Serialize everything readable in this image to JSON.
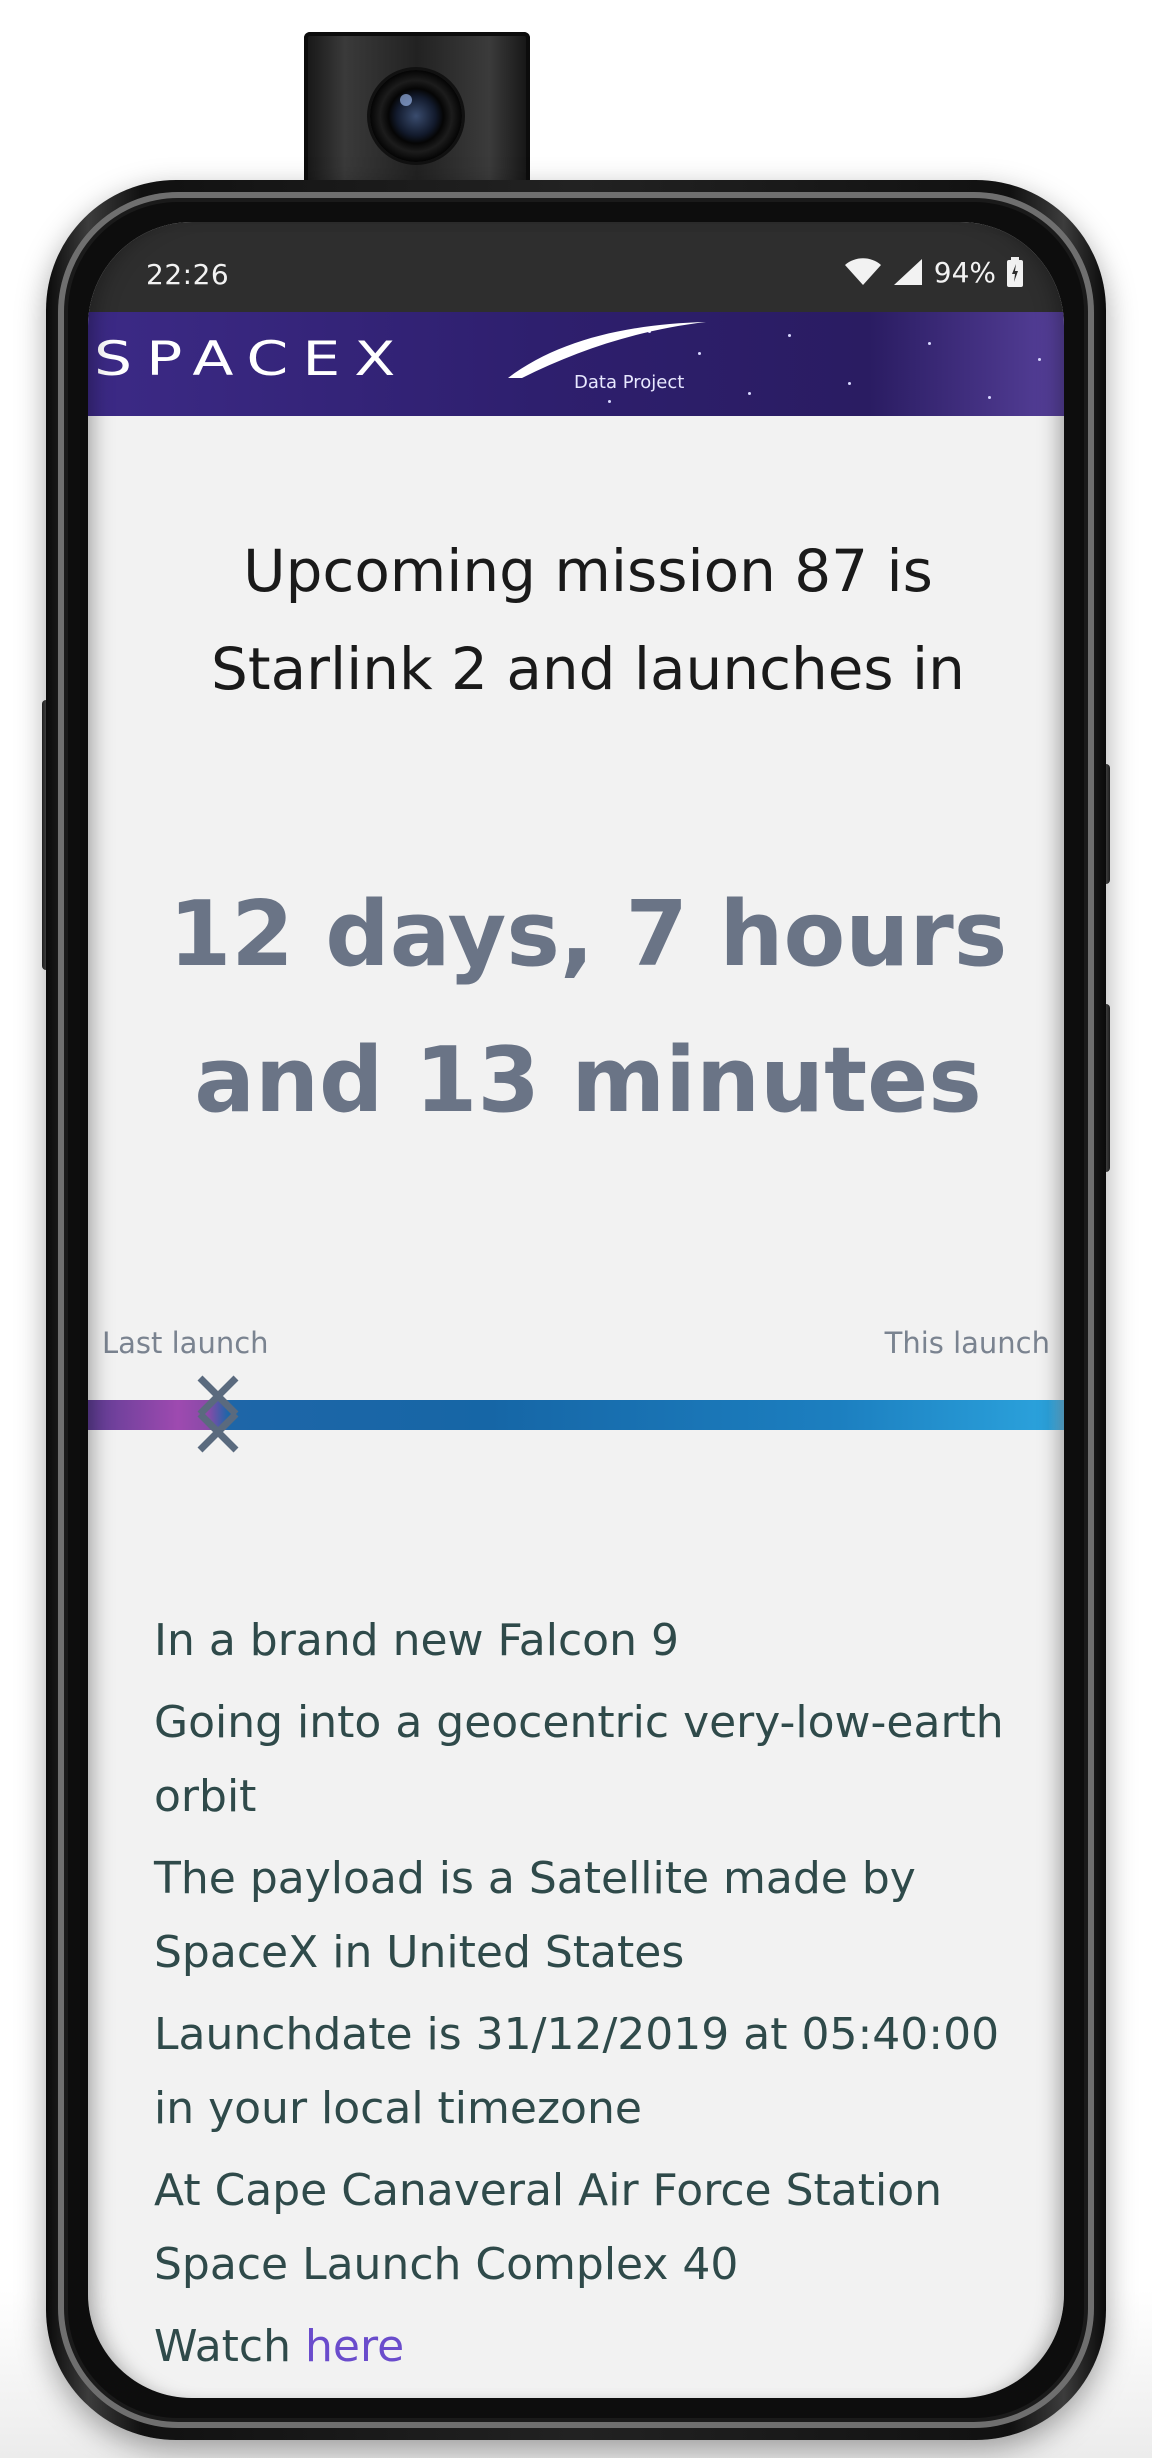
{
  "status_bar": {
    "time": "22:26",
    "battery": "94%",
    "icons": [
      "wifi-icon",
      "signal-icon",
      "battery-icon"
    ]
  },
  "banner": {
    "logo_text": "SPACEX",
    "subtitle": "Data Project"
  },
  "mission": {
    "heading": "Upcoming mission 87 is Starlink 2 and launches in",
    "countdown": "12 days, 7 hours and 13 minutes"
  },
  "timeline": {
    "left_label": "Last launch",
    "right_label": "This launch",
    "progress_fraction": 0.13
  },
  "details": {
    "rocket": "In a brand new Falcon 9",
    "orbit": "Going into a geocentric very-low-earth orbit",
    "payload": "The payload is a Satellite made by SpaceX in United States",
    "launchdate": "Launchdate is 31/12/2019 at 05:40:00 in your local timezone",
    "site": "At Cape Canaveral Air Force Station Space Launch Complex 40",
    "watch_prefix": "Watch",
    "watch_link": "here"
  },
  "colors": {
    "countdown": "#6a7486",
    "link": "#6a4ccc",
    "details_text": "#2f4a4a",
    "banner": "#2e1f6e"
  }
}
